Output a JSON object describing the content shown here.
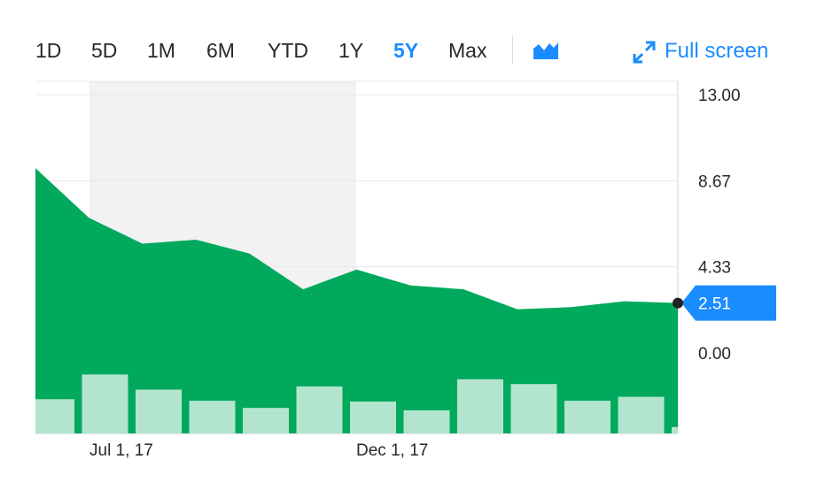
{
  "toolbar": {
    "ranges": [
      "1D",
      "5D",
      "1M",
      "6M",
      "YTD",
      "1Y",
      "5Y",
      "Max"
    ],
    "active_range": "5Y",
    "chart_type_icon": "area-chart-icon",
    "fullscreen_icon": "expand-arrows-icon",
    "fullscreen_label": "Full screen"
  },
  "colors": {
    "accent": "#1a8cff",
    "area": "#00a95c",
    "volume": "#b5e8cd",
    "highlight": "#f2f2f2",
    "grid": "#e6e8eb"
  },
  "chart_data": {
    "type": "area",
    "y_ticks": [
      "13.00",
      "8.67",
      "4.33",
      "0.00"
    ],
    "ylim": [
      0,
      13
    ],
    "x_tick_labels": [
      "Jul 1, 17",
      "Dec 1, 17"
    ],
    "price": [
      9.3,
      6.8,
      5.5,
      5.7,
      5.0,
      3.2,
      4.2,
      3.4,
      3.2,
      2.2,
      2.3,
      2.6,
      2.51
    ],
    "volume": [
      0.43,
      0.74,
      0.55,
      0.41,
      0.32,
      0.59,
      0.4,
      0.29,
      0.68,
      0.62,
      0.41,
      0.46,
      0.08
    ],
    "current_price": "2.51",
    "grid": true
  }
}
